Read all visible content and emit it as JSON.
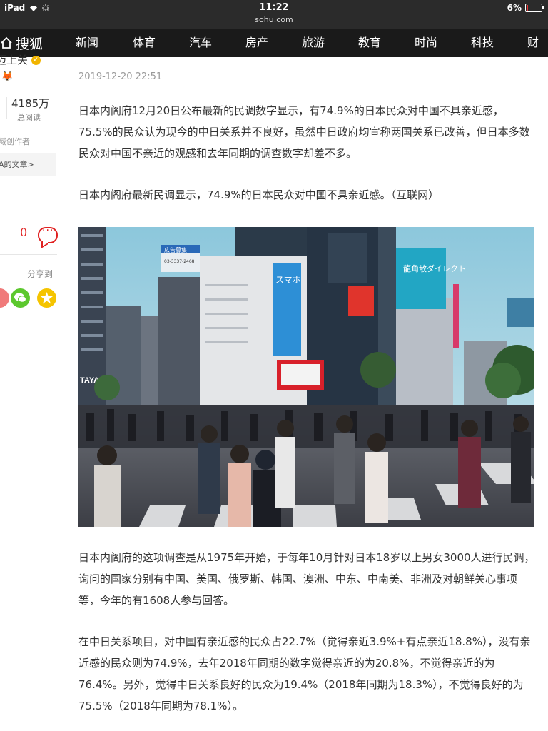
{
  "status_bar": {
    "device": "iPad",
    "time": "11:22",
    "url": "sohu.com",
    "battery": "6%"
  },
  "nav": {
    "logo": "搜狐",
    "items": [
      "新闻",
      "体育",
      "汽车",
      "房产",
      "旅游",
      "教育",
      "时尚",
      "科技",
      "财经"
    ]
  },
  "sidebar": {
    "author_name": "迈上关",
    "reads_count": "4185万",
    "reads_label": "总阅读",
    "author_type": "域创作者",
    "author_articles_link": "A的文章>",
    "comment_count": "0",
    "share_label": "分享到"
  },
  "article": {
    "date": "2019-12-20 22:51",
    "paragraphs": [
      "日本内阁府12月20日公布最新的民调数字显示，有74.9%的日本民众对中国不具亲近感，75.5%的民众认为现今的中日关系并不良好，虽然中日政府均宣称两国关系已改善，但日本多数民众对中国不亲近的观感和去年同期的调查数字却差不多。",
      "日本内阁府最新民调显示，74.9%的日本民众对中国不具亲近感。（互联网）",
      "日本内阁府的这项调查是从1975年开始，于每年10月针对日本18岁以上男女3000人进行民调，询问的国家分别有中国、美国、俄罗斯、韩国、澳洲、中东、中南美、非洲及对朝鲜关心事项等，今年的有1608人参与回答。",
      "在中日关系项目，对中国有亲近感的民众占22.7%（觉得亲近3.9%+有点亲近18.8%），没有亲近感的民众则为74.9%，去年2018年同期的数字觉得亲近的为20.8%，不觉得亲近的为76.4%。另外，觉得中日关系良好的民众为19.4%（2018年同期为18.3%），不觉得良好的为75.5%（2018年同期为78.1%）。"
    ],
    "photo_signs": {
      "sign1": "広告募集",
      "sign1_sub": "03-3337-2468",
      "sign2": "スマホ",
      "sign3": "龍角散ダイレクト",
      "sign4": "TAYA"
    }
  },
  "colors": {
    "status_bg": "#2b2b2b",
    "nav_bg": "#1a1a1a",
    "accent_red": "#e02020",
    "wechat_green": "#5cc82e",
    "star_yellow": "#f5c400"
  }
}
